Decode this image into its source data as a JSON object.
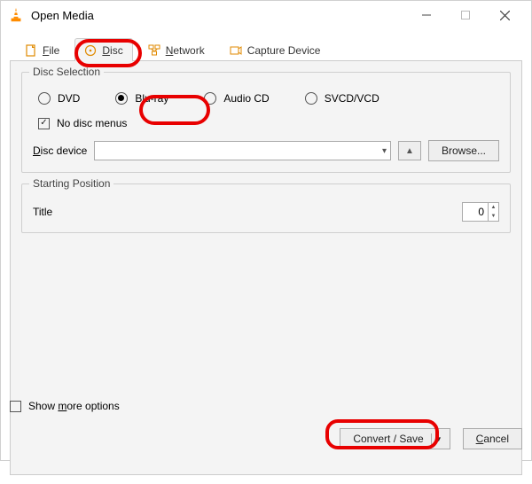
{
  "window": {
    "title": "Open Media",
    "minimize_tip": "Minimize",
    "maximize_tip": "Maximize",
    "close_tip": "Close"
  },
  "tabs": {
    "file_prefix": "F",
    "file_rest": "ile",
    "disc_prefix": "D",
    "disc_rest": "isc",
    "network_prefix": "N",
    "network_rest": "etwork",
    "capture_full": "Capture Device"
  },
  "disc_selection": {
    "legend": "Disc Selection",
    "dvd": "DVD",
    "bluray": "Blu-ray",
    "audiocd": "Audio CD",
    "svcd": "SVCD/VCD",
    "no_menus": "No disc menus",
    "no_menus_checked": true,
    "bluray_selected": true,
    "device_label_prefix": "D",
    "device_label_rest": "isc device",
    "device_value": "",
    "eject_tip": "Eject",
    "browse": "Browse..."
  },
  "starting_position": {
    "legend": "Starting Position",
    "title_label": "Title",
    "title_value": "0"
  },
  "footer": {
    "more_prefix": "Show ",
    "more_mid": "m",
    "more_rest": "ore options",
    "more_checked": false,
    "convert": "Convert / Save",
    "cancel_prefix": "C",
    "cancel_rest": "ancel"
  }
}
